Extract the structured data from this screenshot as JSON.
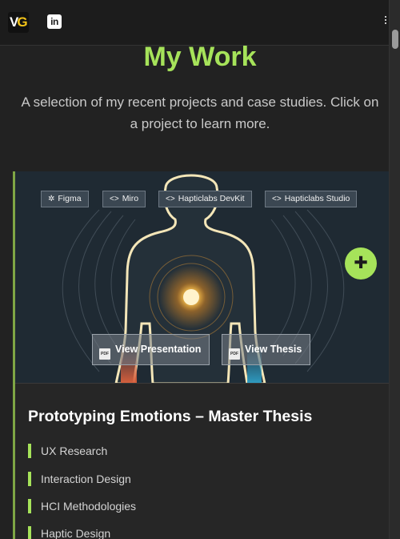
{
  "header": {
    "logo_v": "V",
    "logo_g": "G",
    "linkedin_label": "in"
  },
  "page": {
    "title": "My Work",
    "subtitle": "A selection of my recent projects and case studies. Click on a project to learn more."
  },
  "project": {
    "tags": [
      {
        "label": "Figma",
        "icon": "figma-icon"
      },
      {
        "label": "Miro",
        "icon": "code-icon"
      },
      {
        "label": "Hapticlabs DevKit",
        "icon": "code-icon"
      },
      {
        "label": "Hapticlabs Studio",
        "icon": "code-icon"
      }
    ],
    "buttons": {
      "presentation": "View Presentation",
      "thesis": "View Thesis",
      "pdf_badge": "PDF"
    },
    "title": "Prototyping Emotions – Master Thesis",
    "skills": [
      "UX Research",
      "Interaction Design",
      "HCI Methodologies",
      "Haptic Design"
    ]
  },
  "colors": {
    "accent": "#a6e35a",
    "background": "#222222",
    "card_border": "#7fa645"
  }
}
